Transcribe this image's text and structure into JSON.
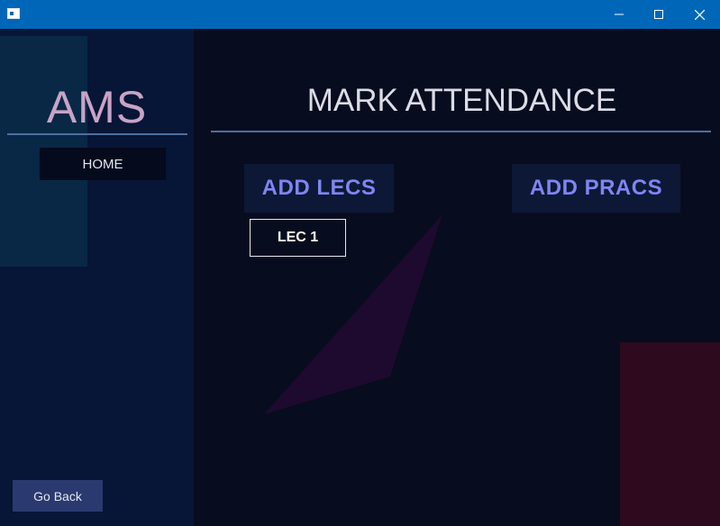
{
  "window": {
    "icon": "app-window-icon",
    "controls": {
      "minimize": "minimize-icon",
      "maximize": "maximize-icon",
      "close": "close-icon"
    }
  },
  "sidebar": {
    "logo": "AMS",
    "home_label": "HOME",
    "back_label": "Go Back"
  },
  "main": {
    "title": "MARK ATTENDANCE",
    "add_lecs_label": "ADD LECS",
    "add_pracs_label": "ADD PRACS",
    "lectures": [
      {
        "label": "LEC 1"
      }
    ]
  },
  "colors": {
    "titlebar": "#0067b8",
    "sidebar_bg": "#071536",
    "main_bg": "#070c1f",
    "accent_text": "#7f85f2",
    "logo_text": "#c9a3c6",
    "rule": "#4d6fa0",
    "go_back_bg": "#2a3a70"
  }
}
